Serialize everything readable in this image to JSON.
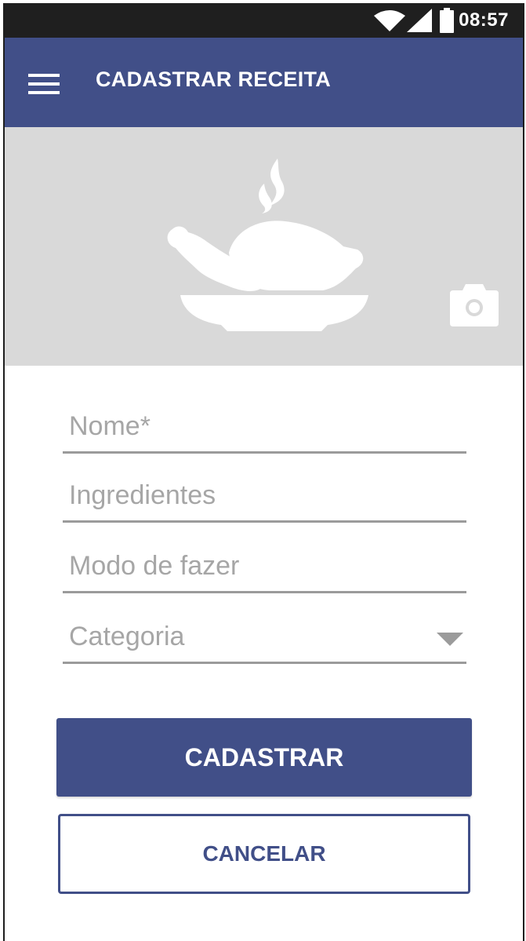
{
  "status_bar": {
    "time": "08:57",
    "icons": [
      "wifi-icon",
      "signal-icon",
      "battery-icon"
    ]
  },
  "app_bar": {
    "title": "CADASTRAR RECEITA",
    "menu_icon": "hamburger-menu-icon"
  },
  "hero": {
    "image_icon": "roast-chicken-dish-icon",
    "camera_icon": "camera-icon"
  },
  "form": {
    "fields": [
      {
        "placeholder": "Nome*",
        "value": ""
      },
      {
        "placeholder": "Ingredientes",
        "value": ""
      },
      {
        "placeholder": "Modo de fazer",
        "value": ""
      },
      {
        "placeholder": "Categoria",
        "value": ""
      }
    ]
  },
  "actions": {
    "submit_label": "CADASTRAR",
    "cancel_label": "CANCELAR"
  },
  "colors": {
    "primary": "#414f88",
    "status_bar": "#1f1f1f",
    "hero_bg": "#d9d9d9",
    "placeholder": "#a6a6a6",
    "underline": "#9b9b9b"
  }
}
